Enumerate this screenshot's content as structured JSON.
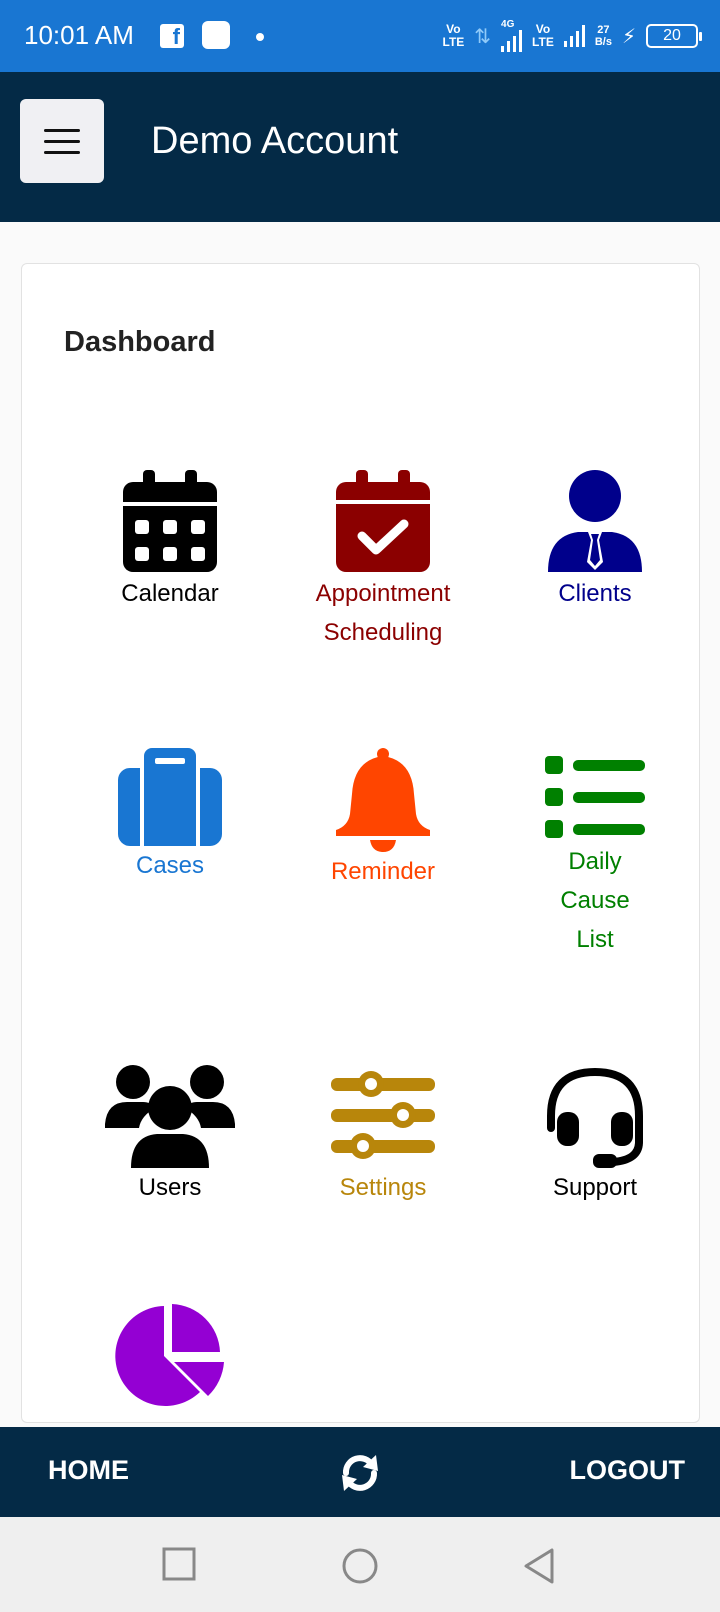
{
  "status_bar": {
    "time": "10:01 AM",
    "net1_top": "Vo",
    "net1_bottom": "LTE",
    "net2_top": "4G",
    "net3_top": "Vo",
    "net3_bottom": "LTE",
    "speed_top": "27",
    "speed_bottom": "B/s",
    "battery": "20"
  },
  "header": {
    "title": "Demo Account"
  },
  "dashboard": {
    "title": "Dashboard",
    "tiles": [
      {
        "label": "Calendar",
        "color": "#000000"
      },
      {
        "label": "Appointment Scheduling",
        "color": "#8b0000"
      },
      {
        "label": "Clients",
        "color": "#00008b"
      },
      {
        "label": "Cases",
        "color": "#1976d2"
      },
      {
        "label": "Reminder",
        "color": "#ff4500"
      },
      {
        "label": "Daily Cause List",
        "color": "#008000"
      },
      {
        "label": "Users",
        "color": "#000000"
      },
      {
        "label": "Settings",
        "color": "#b8860b"
      },
      {
        "label": "Support",
        "color": "#000000"
      },
      {
        "label": "",
        "color": "#9400d3"
      }
    ]
  },
  "bottom_nav": {
    "home": "HOME",
    "logout": "LOGOUT"
  }
}
